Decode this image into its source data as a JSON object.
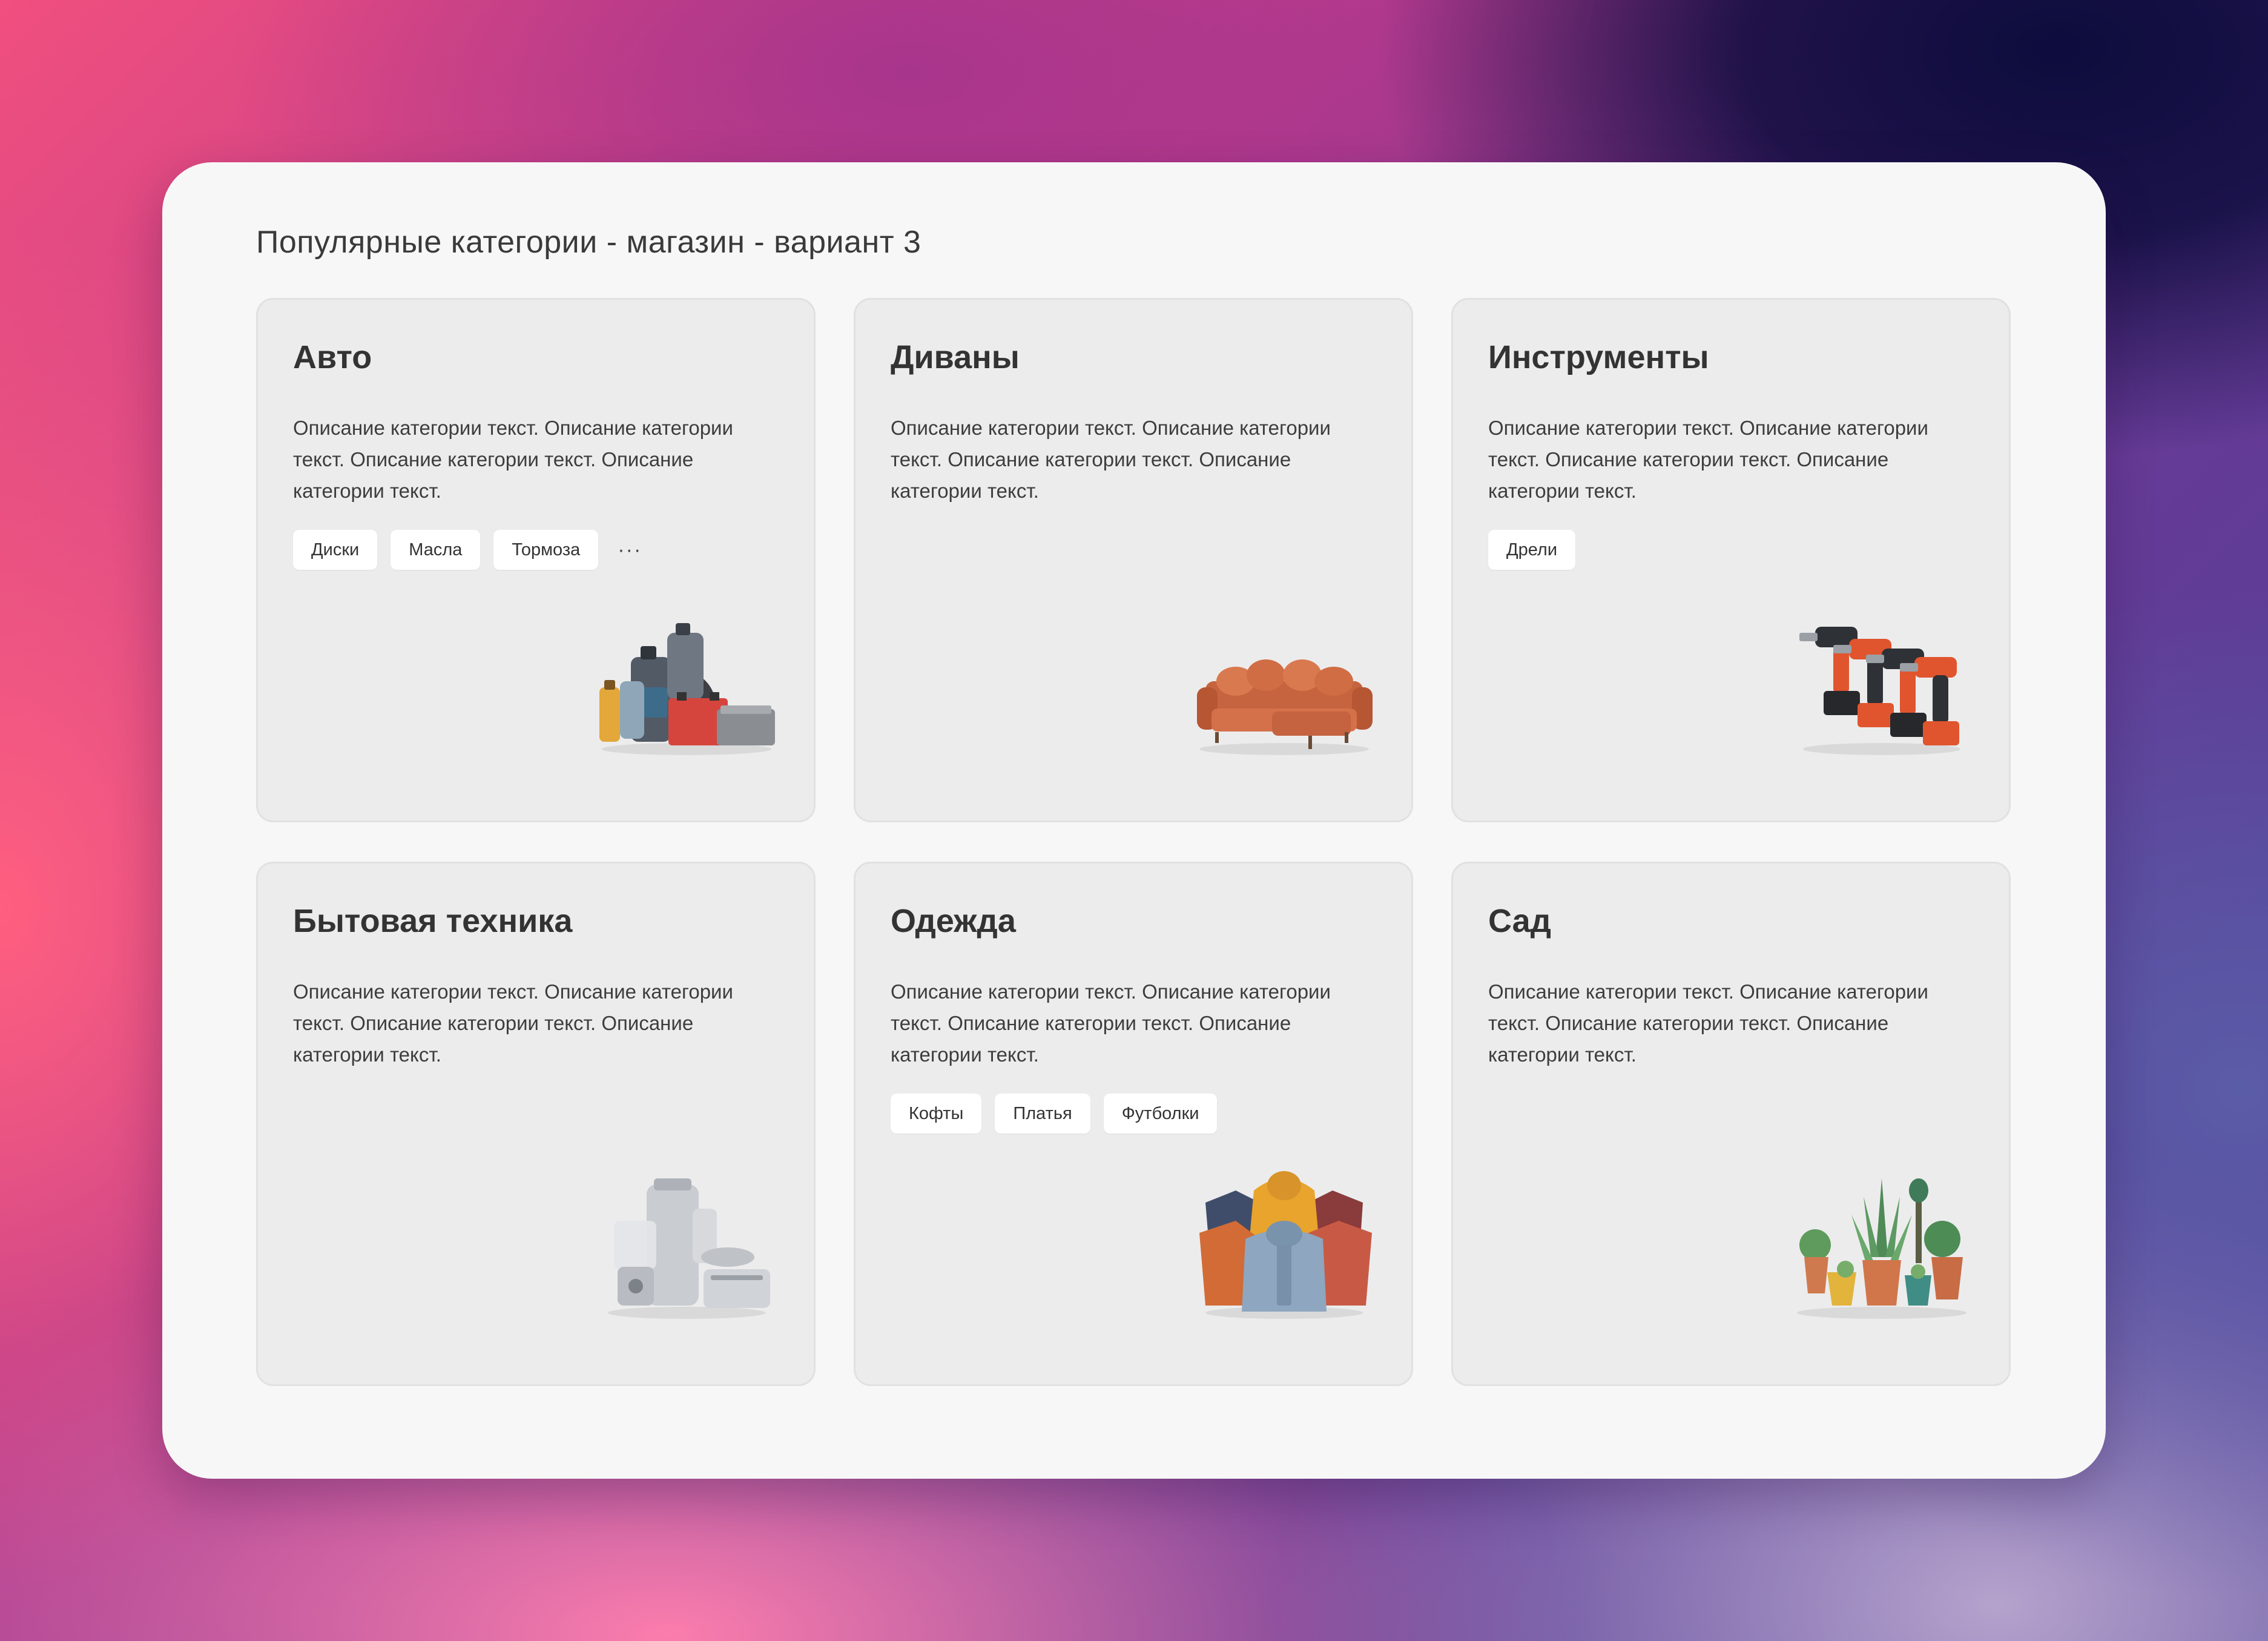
{
  "page": {
    "title": "Популярные категории - магазин - вариант 3"
  },
  "categories": [
    {
      "title": "Авто",
      "description": "Описание категории текст. Описание категории текст. Описание категории текст. Описание категории текст.",
      "tags": [
        "Диски",
        "Масла",
        "Тормоза"
      ],
      "more": "···",
      "image": "auto-products-illustration"
    },
    {
      "title": "Диваны",
      "description": "Описание категории текст. Описание категории текст. Описание категории текст. Описание категории текст.",
      "tags": [],
      "image": "sofa-illustration"
    },
    {
      "title": "Инструменты",
      "description": "Описание категории текст. Описание категории текст. Описание категории текст. Описание категории текст.",
      "tags": [
        "Дрели"
      ],
      "image": "drills-illustration"
    },
    {
      "title": "Бытовая техника",
      "description": "Описание категории текст. Описание категории текст. Описание категории текст. Описание категории текст.",
      "tags": [],
      "image": "appliances-illustration"
    },
    {
      "title": "Одежда",
      "description": "Описание категории текст. Описание категории текст. Описание категории текст. Описание категории текст.",
      "tags": [
        "Кофты",
        "Платья",
        "Футболки"
      ],
      "image": "hoodies-illustration"
    },
    {
      "title": "Сад",
      "description": "Описание категории текст. Описание категории текст. Описание категории текст. Описание категории текст.",
      "tags": [],
      "image": "plants-illustration"
    }
  ]
}
